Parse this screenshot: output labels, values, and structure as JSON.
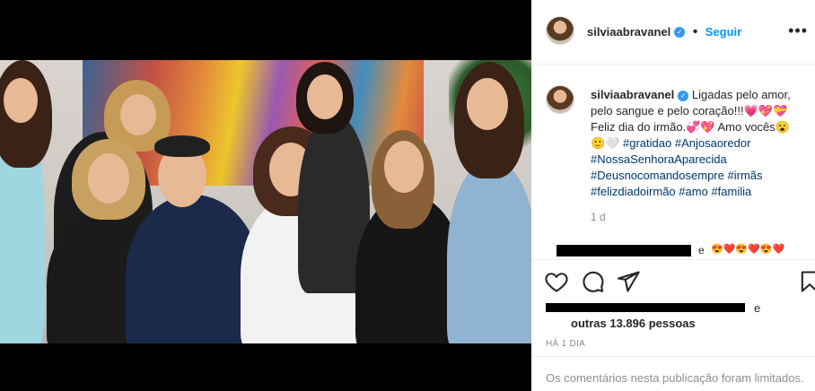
{
  "post": {
    "username": "silviaabravanel",
    "follow_label": "Seguir",
    "more_label": "•••",
    "caption_text": "Ligadas pelo amor, pelo sangue e pelo coração!!!💗💖💝 Feliz dia do irmão.💞💖 Amo vocês😮 🙂🤍",
    "hashtags": [
      "#gratidao",
      "#Anjosaoredor",
      "#NossaSenhoraAparecida",
      "#Deusnocomandosempre",
      "#irmãs",
      "#felizdiadoirmão",
      "#amo",
      "#familia"
    ],
    "time_short": "1 d",
    "comment_suffix": "e",
    "comment_emojis": "😍❤️😍❤️😍❤️",
    "likes_conj": "e",
    "likes_others": "outras 13.896 pessoas",
    "time_ago": "HÁ 1 DIA",
    "comments_limited": "Os comentários nesta publicação foram limitados."
  },
  "icons": {
    "verified": "verified-badge-icon",
    "like": "heart-icon",
    "comment": "comment-bubble-icon",
    "share": "paper-plane-icon",
    "save": "bookmark-icon",
    "more": "more-options-icon"
  },
  "colors": {
    "link_blue": "#0095f6",
    "hashtag": "#00376b",
    "verified": "#3897f0",
    "muted": "#8e8e8e"
  }
}
